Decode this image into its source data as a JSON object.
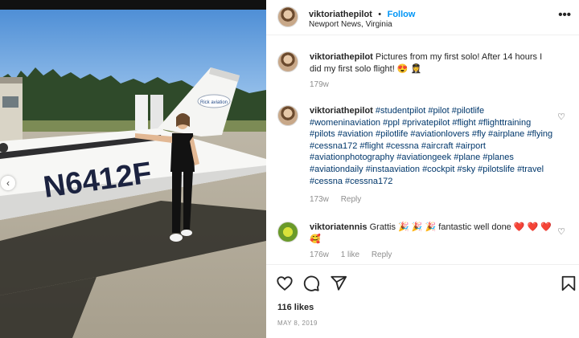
{
  "post": {
    "username": "viktoriathepilot",
    "follow_label": "Follow",
    "separator": "•",
    "location": "Newport News, Virginia",
    "more_icon": "more-horizontal-icon",
    "photo": {
      "tail_number": "N6412F",
      "tail_logo_text": "Rick aviation"
    }
  },
  "caption": {
    "username": "viktoriathepilot",
    "text": "Pictures from my first solo! After 14 hours I did my first solo flight! 😍 👩‍✈️",
    "time": "179w"
  },
  "hashtag_comment": {
    "username": "viktoriathepilot",
    "tags": [
      "#studentpilot",
      "#pilot",
      "#pilotlife",
      "#womeninaviation",
      "#ppl",
      "#privatepilot",
      "#flight",
      "#flighttraining",
      "#pilots",
      "#aviation",
      "#pilotlife",
      "#aviationlovers",
      "#fly",
      "#airplane",
      "#flying",
      "#cessna172",
      "#flight",
      "#cessna",
      "#aircraft",
      "#airport",
      "#aviationphotography",
      "#aviationgeek",
      "#plane",
      "#planes",
      "#aviationdaily",
      "#instaaviation",
      "#cockpit",
      "#sky",
      "#pilotslife",
      "#travel",
      "#cessna",
      "#cessna172"
    ],
    "time": "173w",
    "reply_label": "Reply"
  },
  "reply_comment": {
    "username": "viktoriatennis",
    "text": "Grattis 🎉 🎉 🎉 fantastic well done ❤️ ❤️ ❤️ 🥰",
    "time": "176w",
    "likes_label": "1 like",
    "reply_label": "Reply"
  },
  "actions": {
    "likes": "116 likes",
    "date": "MAY 8, 2019"
  }
}
